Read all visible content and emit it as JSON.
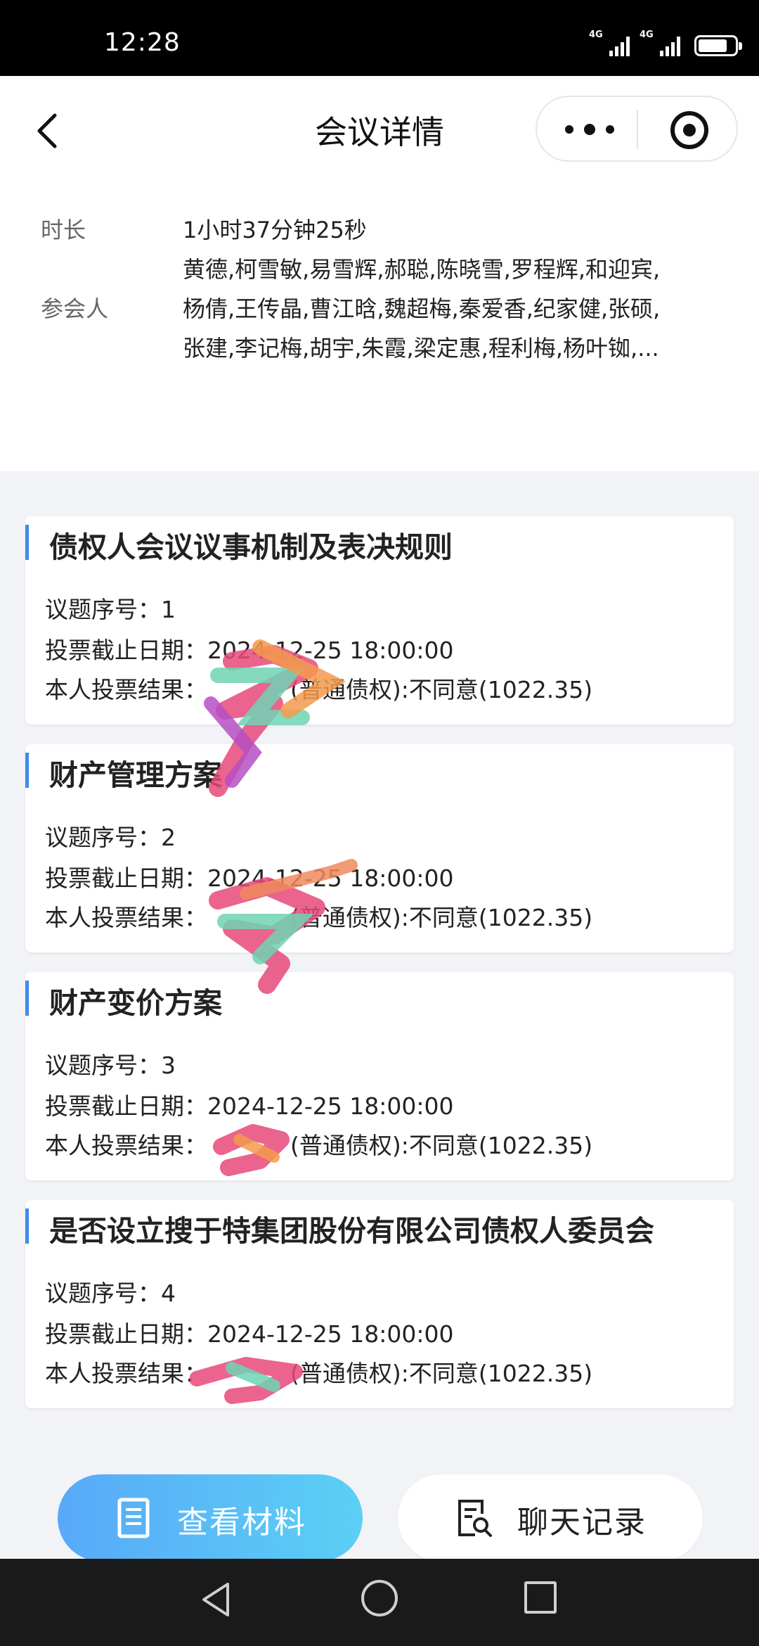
{
  "status_bar": {
    "time": "12:28",
    "sim1": "4G",
    "sim2": "4G"
  },
  "nav": {
    "title": "会议详情"
  },
  "meeting": {
    "duration_label": "时长",
    "duration_value": "1小时37分钟25秒",
    "attendees_label": "参会人",
    "attendee_lines": [
      "黄德,柯雪敏,易雪辉,郝聪,陈晓雪,罗程辉,和迎宾,",
      "杨倩,王传晶,曹江晗,魏超梅,秦爱香,纪家健,张硕,",
      "张建,李记梅,胡宇,朱霞,梁定惠,程利梅,杨叶铷,..."
    ]
  },
  "labels": {
    "index": "议题序号：",
    "deadline": "投票截止日期：",
    "result": "本人投票结果："
  },
  "agenda_items": [
    {
      "title": "债权人会议议事机制及表决规则",
      "index": "1",
      "deadline": "2024-12-25 18:00:00",
      "result": "(普通债权):不同意(1022.35)"
    },
    {
      "title": "财产管理方案",
      "index": "2",
      "deadline": "2024-12-25 18:00:00",
      "result": "(普通债权):不同意(1022.35)"
    },
    {
      "title": "财产变价方案",
      "index": "3",
      "deadline": "2024-12-25 18:00:00",
      "result": "(普通债权):不同意(1022.35)"
    },
    {
      "title": "是否设立搜于特集团股份有限公司债权人委员会",
      "index": "4",
      "deadline": "2024-12-25 18:00:00",
      "result": "(普通债权):不同意(1022.35)"
    }
  ],
  "buttons": {
    "materials": "查看材料",
    "chat": "聊天记录"
  },
  "colors": {
    "accent": "#3c8cf0",
    "button_gradient_start": "#58a9f8",
    "button_gradient_end": "#5bd0f5"
  }
}
